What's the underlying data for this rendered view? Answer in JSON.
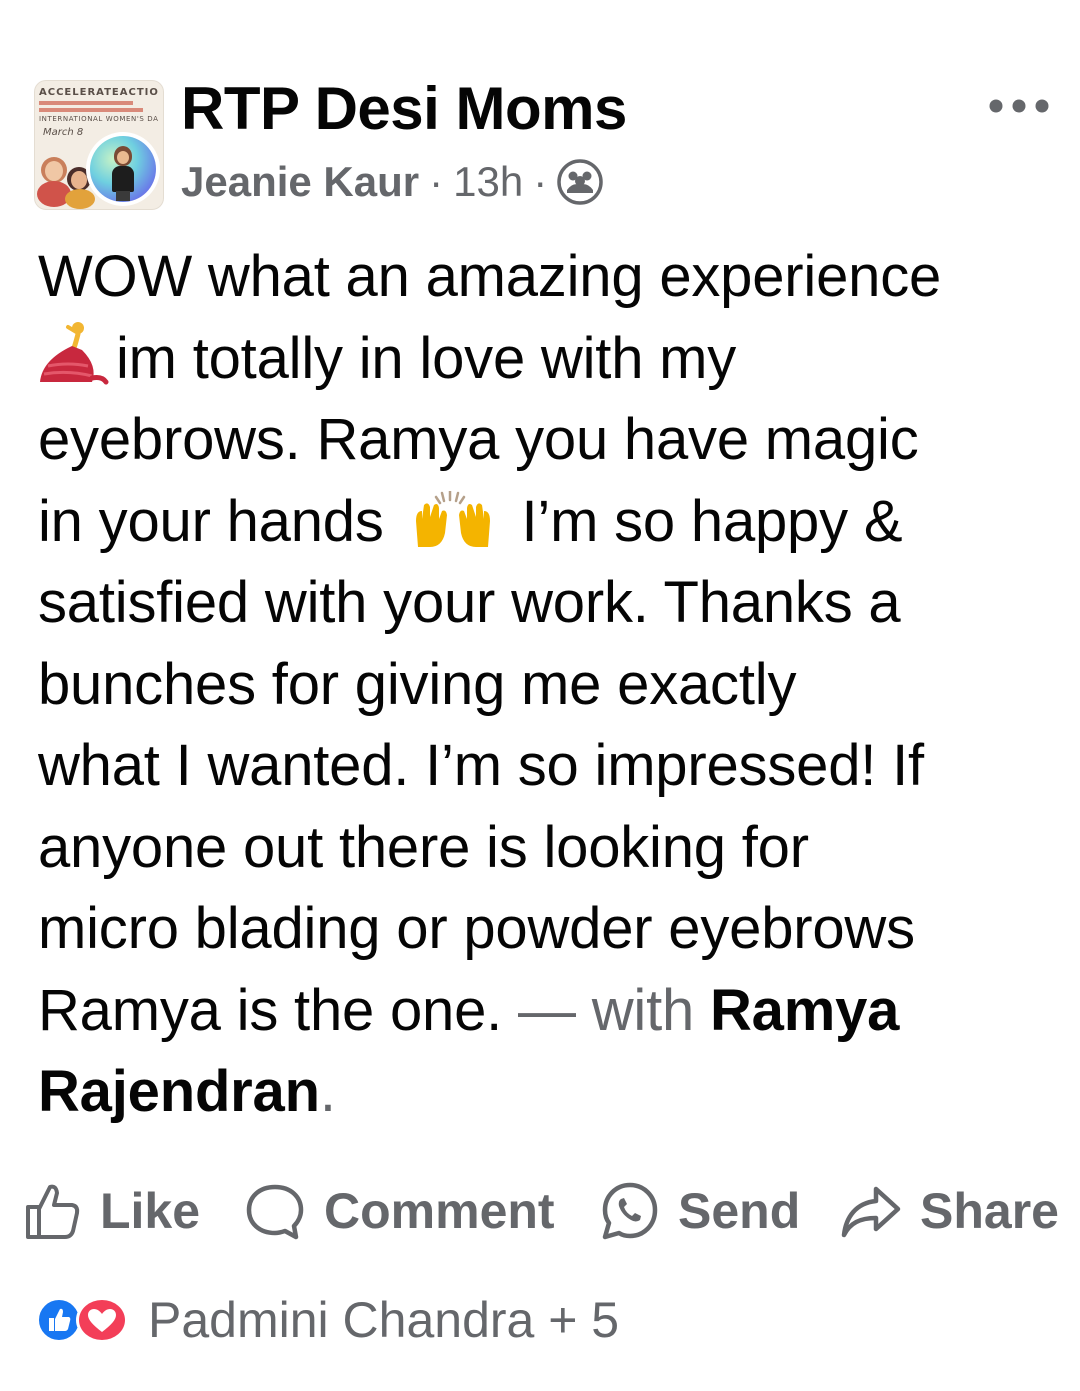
{
  "post": {
    "group_name": "RTP Desi Moms",
    "author": "Jeanie Kaur",
    "separator": "·",
    "time": "13h",
    "audience_icon": "group-members-icon",
    "more_icon": "more-options-icon",
    "group_avatar_text": {
      "line1": "ACCELERATEACTIO",
      "line2": "INTERNATIONAL WOMEN'S DA",
      "line3": "March 8"
    },
    "lines": [
      "WOW what an amazing experience",
      "im totally in love with my",
      "eyebrows. Ramya you have magic",
      "in your hands",
      "I’m so happy &",
      "satisfied with your work. Thanks a",
      "bunches for giving me exactly",
      "what I wanted. I’m so impressed! If",
      "anyone out there is looking for",
      "micro blading or powder eyebrows",
      "Ramya is the one.",
      "— with",
      "Ramya",
      "Rajendran",
      "."
    ],
    "emojis": [
      "dancer-emoji",
      "raising-hands-emoji"
    ]
  },
  "actions": {
    "like": "Like",
    "comment": "Comment",
    "send": "Send",
    "share": "Share"
  },
  "reactions": {
    "text": "Padmini Chandra + 5",
    "icons": [
      "like-reaction-icon",
      "love-reaction-icon"
    ],
    "colors": {
      "like": "#1877f2",
      "love": "#f33e58"
    }
  },
  "colors": {
    "text": "#050505",
    "secondary": "#65676b",
    "background": "#ffffff"
  }
}
